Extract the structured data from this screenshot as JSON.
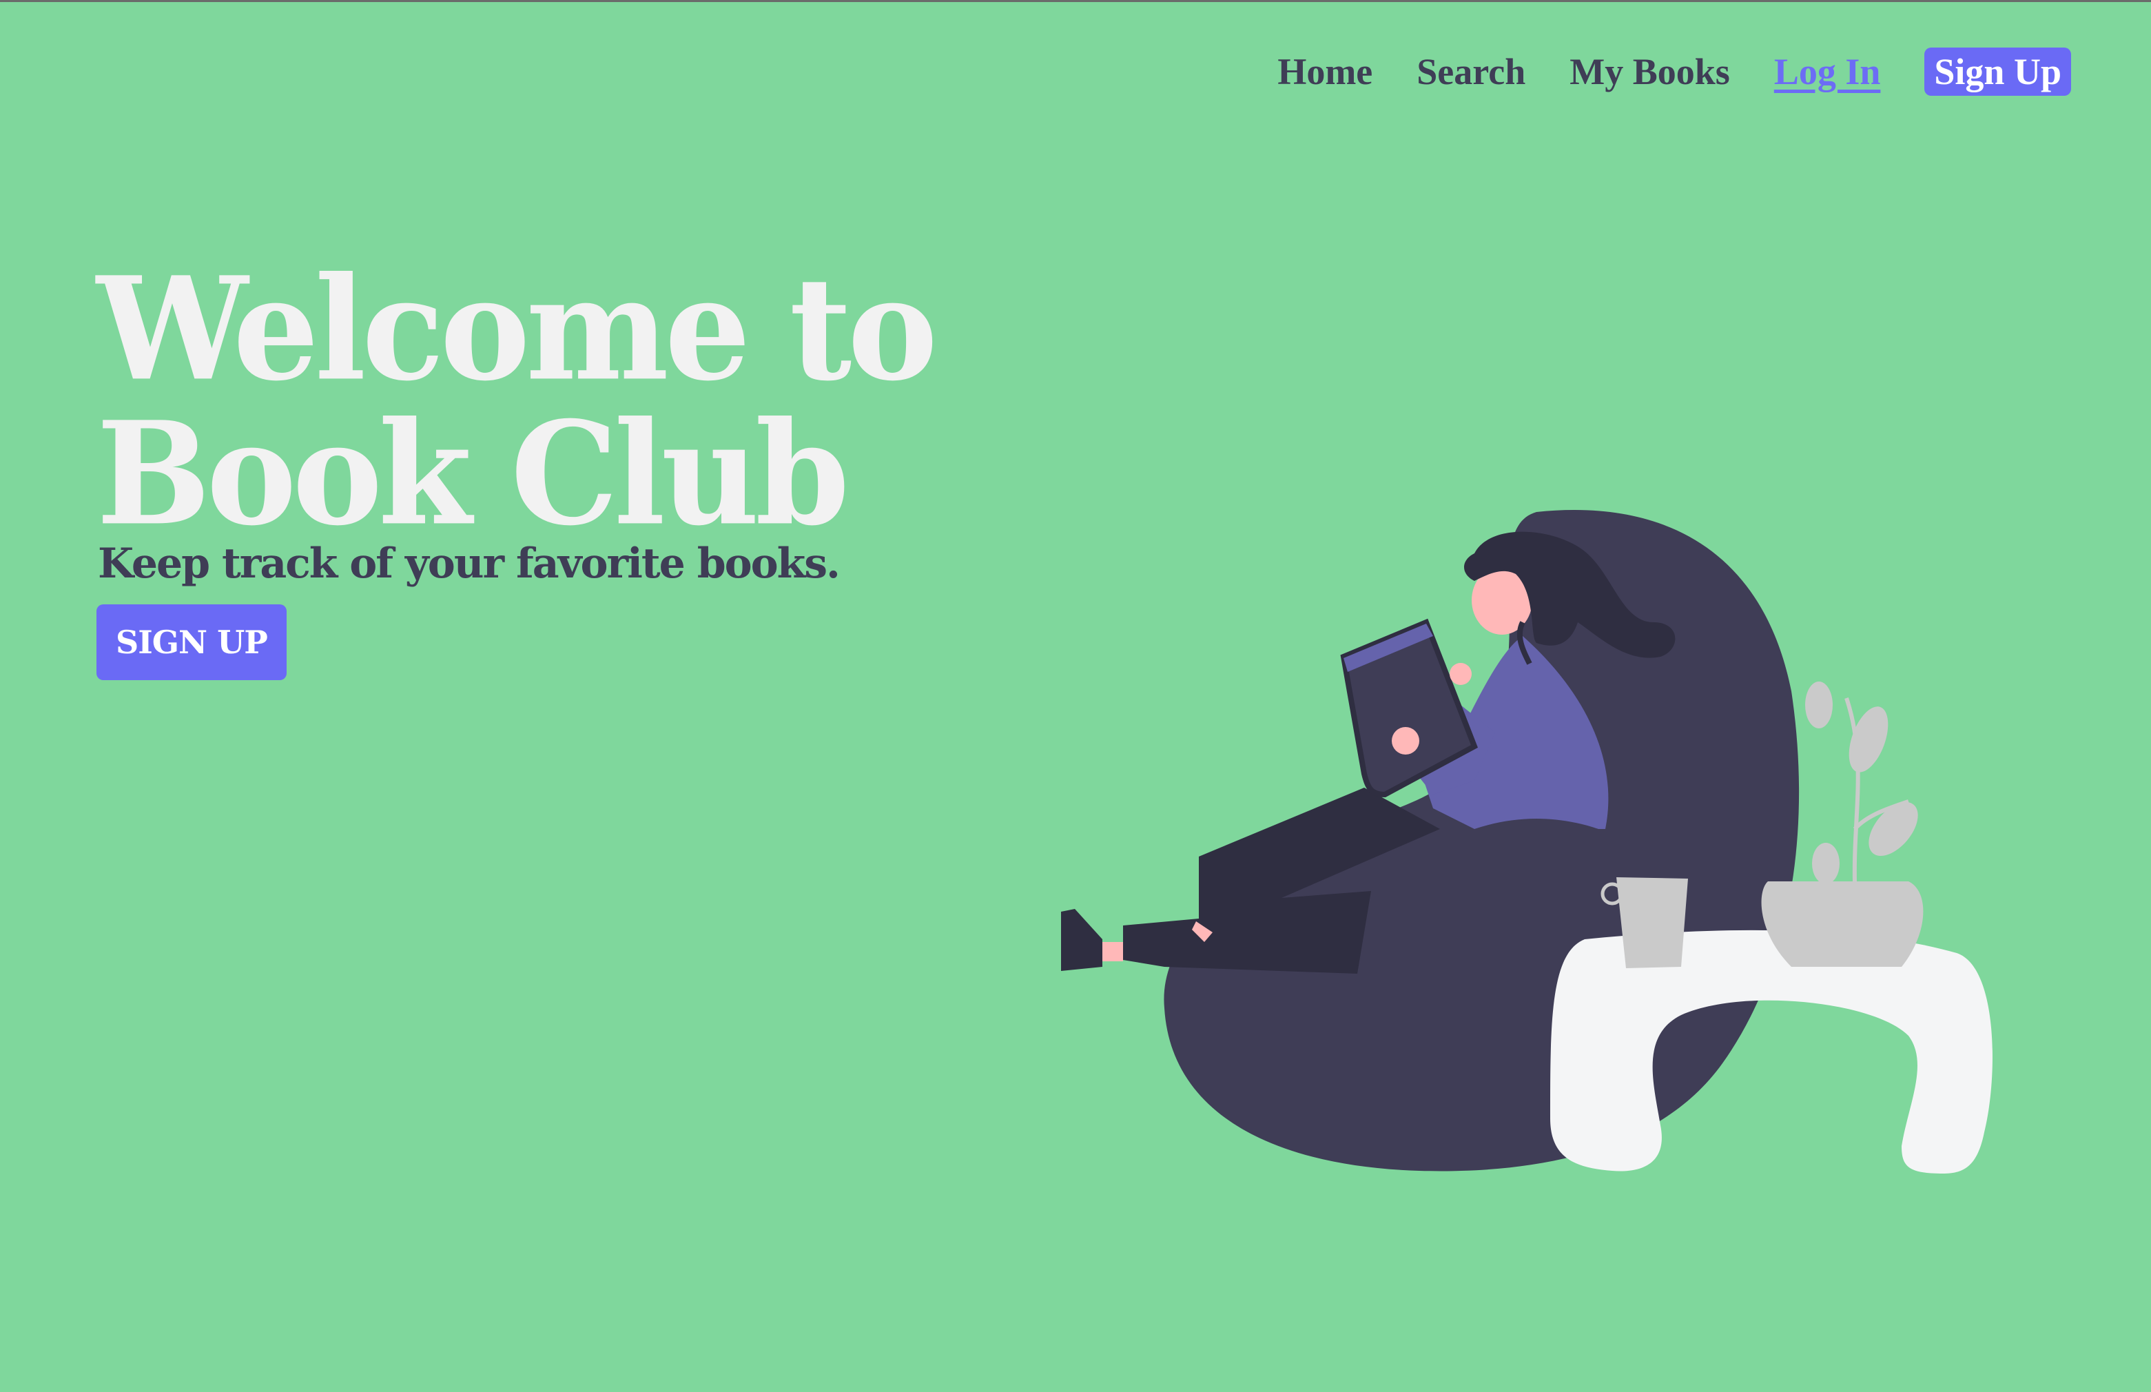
{
  "nav": {
    "items": [
      {
        "label": "Home"
      },
      {
        "label": "Search"
      },
      {
        "label": "My Books"
      },
      {
        "label": "Log In"
      },
      {
        "label": "Sign Up"
      }
    ]
  },
  "hero": {
    "title": "Welcome to Book Club",
    "subtitle": "Keep track of your favorite books.",
    "cta_label": "SIGN UP"
  },
  "illustration": {
    "icon": "woman-reading-on-beanbag-illustration"
  },
  "colors": {
    "background": "#7fd79c",
    "accent": "#6a6af5",
    "text_dark": "#3f3d56",
    "title": "#f2f2f2"
  }
}
